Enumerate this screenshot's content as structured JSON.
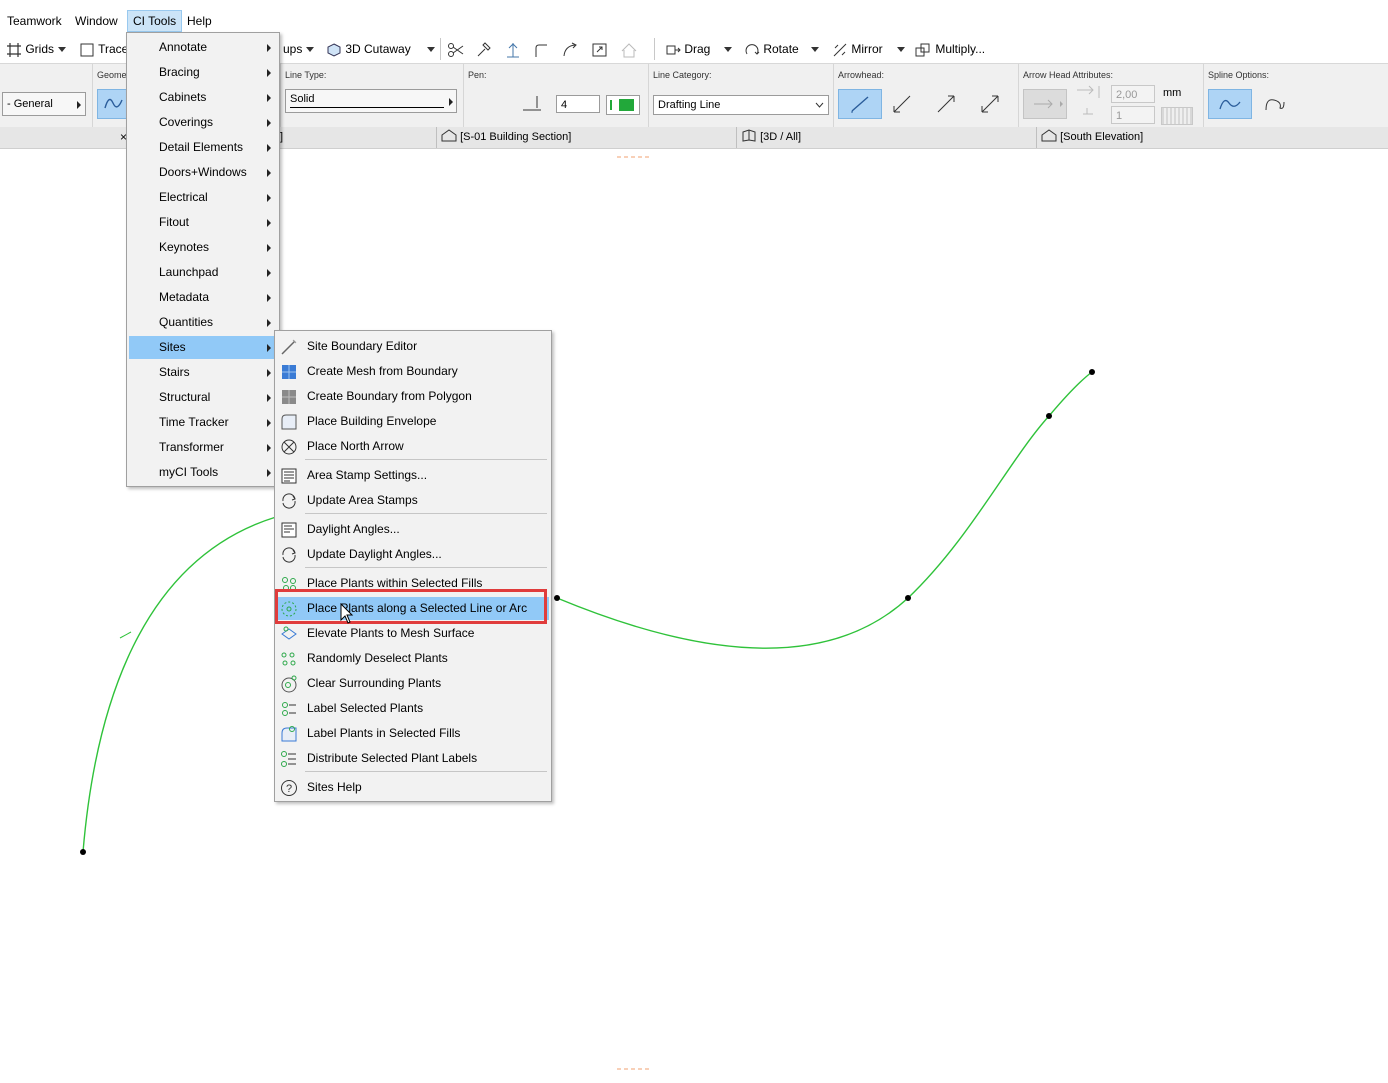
{
  "menubar": {
    "items": [
      {
        "label": "Teamwork"
      },
      {
        "label": "Window"
      },
      {
        "label": "CI Tools"
      },
      {
        "label": "Help"
      }
    ]
  },
  "toolbar": {
    "grids": "Grids",
    "trace": "Trace",
    "groups_fragment": "ups",
    "cutaway": "3D Cutaway",
    "drag": "Drag",
    "rotate": "Rotate",
    "mirror": "Mirror",
    "multiply": "Multiply..."
  },
  "infobox": {
    "general": "- General",
    "geometry_fragment": "Geome",
    "line_type_label": "Line Type:",
    "line_type_value": "Solid",
    "pen_label": "Pen:",
    "pen_value": "4",
    "line_category_label": "Line Category:",
    "line_category_value": "Drafting Line",
    "arrowhead_label": "Arrowhead:",
    "arrow_attr_label": "Arrow Head Attributes:",
    "arrow_size": "2,00",
    "arrow_unit": "mm",
    "arrow_pen": "1",
    "spline_label": "Spline Options:",
    "pen_color": "#22a83a"
  },
  "tabs": [
    {
      "label": "]"
    },
    {
      "label": "[S-01 Building Section]"
    },
    {
      "label": "[3D / All]"
    },
    {
      "label": "[South Elevation]"
    }
  ],
  "ci_menu": {
    "items": [
      {
        "label": "Annotate"
      },
      {
        "label": "Bracing"
      },
      {
        "label": "Cabinets"
      },
      {
        "label": "Coverings"
      },
      {
        "label": "Detail Elements"
      },
      {
        "label": "Doors+Windows"
      },
      {
        "label": "Electrical"
      },
      {
        "label": "Fitout"
      },
      {
        "label": "Keynotes"
      },
      {
        "label": "Launchpad"
      },
      {
        "label": "Metadata"
      },
      {
        "label": "Quantities"
      },
      {
        "label": "Sites"
      },
      {
        "label": "Stairs"
      },
      {
        "label": "Structural"
      },
      {
        "label": "Time Tracker"
      },
      {
        "label": "Transformer"
      },
      {
        "label": "myCI Tools"
      }
    ]
  },
  "sites_menu": {
    "items": [
      {
        "label": "Site Boundary Editor",
        "icon": "pen-icon"
      },
      {
        "label": "Create Mesh from Boundary",
        "icon": "mesh-icon"
      },
      {
        "label": "Create Boundary from Polygon",
        "icon": "polygon-icon"
      },
      {
        "label": "Place Building Envelope",
        "icon": "envelope-icon"
      },
      {
        "label": "Place North Arrow",
        "icon": "north-arrow-icon"
      },
      {
        "label": "Area Stamp Settings...",
        "icon": "stamp-settings-icon"
      },
      {
        "label": "Update Area Stamps",
        "icon": "refresh-icon"
      },
      {
        "label": "Daylight Angles...",
        "icon": "daylight-icon"
      },
      {
        "label": "Update Daylight Angles...",
        "icon": "refresh-icon"
      },
      {
        "label": "Place Plants within Selected Fills",
        "icon": "plants-fill-icon"
      },
      {
        "label": "Place Plants along a Selected Line or Arc",
        "icon": "plants-line-icon"
      },
      {
        "label": "Elevate Plants to Mesh Surface",
        "icon": "elevate-plants-icon"
      },
      {
        "label": "Randomly Deselect Plants",
        "icon": "random-plants-icon"
      },
      {
        "label": "Clear Surrounding Plants",
        "icon": "clear-plants-icon"
      },
      {
        "label": "Label Selected Plants",
        "icon": "label-plants-icon"
      },
      {
        "label": "Label Plants in Selected Fills",
        "icon": "label-fills-icon"
      },
      {
        "label": "Distribute Selected Plant Labels",
        "icon": "distribute-labels-icon"
      },
      {
        "label": "Sites Help",
        "icon": "help-icon"
      }
    ]
  },
  "colors": {
    "spline": "#2fc23a",
    "highlight": "#91c9f7",
    "callout": "#e03c3c",
    "marker": "#f0a070"
  }
}
